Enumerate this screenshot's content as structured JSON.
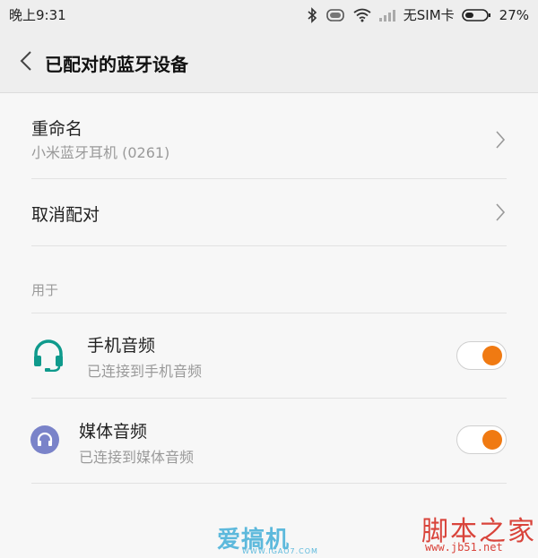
{
  "status_bar": {
    "time": "晚上9:31",
    "carrier": "无SIM卡",
    "battery_percent": "27%",
    "icons": [
      "bluetooth-icon",
      "vibrate-icon",
      "wifi-icon",
      "signal-icon",
      "battery-icon"
    ]
  },
  "header": {
    "title": "已配对的蓝牙设备",
    "back_icon": "chevron-left-icon"
  },
  "settings": {
    "rename": {
      "label": "重命名",
      "value": "小米蓝牙耳机 (0261)"
    },
    "unpair": {
      "label": "取消配对"
    },
    "section_label": "用于",
    "profiles": [
      {
        "label": "手机音频",
        "status": "已连接到手机音频",
        "icon": "headset-icon",
        "enabled": true
      },
      {
        "label": "媒体音频",
        "status": "已连接到媒体音频",
        "icon": "headphones-icon",
        "enabled": true
      }
    ]
  },
  "watermarks": {
    "aigaoji": "爱搞机",
    "aigaoji_url": "WWW.IGAO7.COM",
    "jb51": "脚本之家",
    "jb51_url": "www.jb51.net"
  },
  "colors": {
    "accent": "#f07a12",
    "headset_icon": "#0f9a8c",
    "headphones_icon": "#7a83c9"
  }
}
